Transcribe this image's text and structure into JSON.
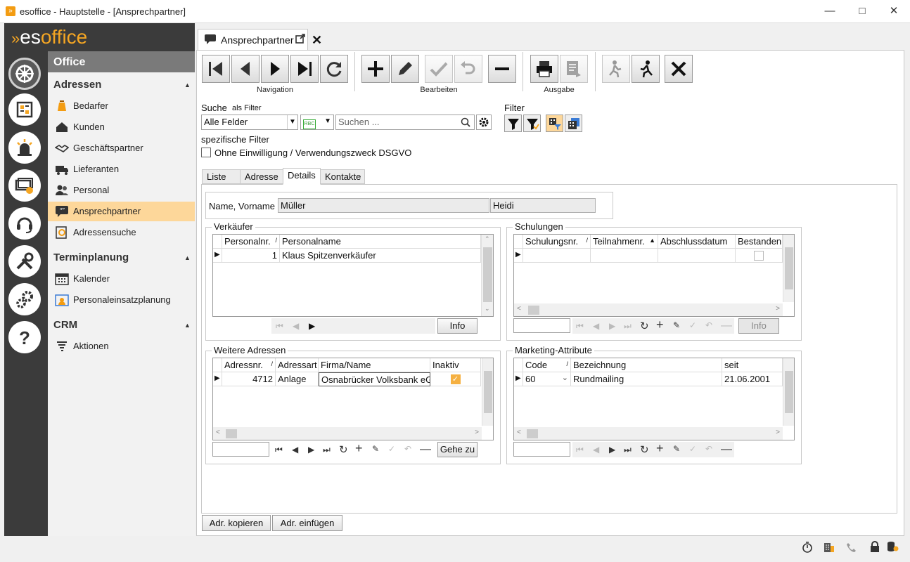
{
  "window": {
    "title": "esoffice - Hauptstelle - [Ansprechpartner]"
  },
  "brand": {
    "logo_es": "es",
    "logo_office": "office"
  },
  "nav": {
    "header": "Office",
    "groups": [
      {
        "title": "Adressen",
        "items": [
          "Bedarfer",
          "Kunden",
          "Geschäftspartner",
          "Lieferanten",
          "Personal",
          "Ansprechpartner",
          "Adressensuche"
        ]
      },
      {
        "title": "Terminplanung",
        "items": [
          "Kalender",
          "Personaleinsatzplanung"
        ]
      },
      {
        "title": "CRM",
        "items": [
          "Aktionen"
        ]
      }
    ],
    "selected": "Ansprechpartner"
  },
  "doc_tab": {
    "label": "Ansprechpartner"
  },
  "toolbar": {
    "navigation_label": "Navigation",
    "bearbeiten_label": "Bearbeiten",
    "ausgabe_label": "Ausgabe"
  },
  "search": {
    "label": "Suche",
    "as_filter": "als Filter",
    "field_select": "Alle Felder",
    "placeholder": "Suchen ...",
    "filter_label": "Filter"
  },
  "specific_filter": {
    "label": "spezifische Filter",
    "checkbox_label": "Ohne Einwilligung / Verwendungszweck DSGVO",
    "checked": false
  },
  "tabs": [
    "Liste",
    "Adresse",
    "Details",
    "Kontakte"
  ],
  "active_tab": "Details",
  "name": {
    "label": "Name, Vorname",
    "last": "Müller",
    "first": "Heidi"
  },
  "verkaeufer": {
    "title": "Verkäufer",
    "columns": [
      "Personalnr.",
      "Personalname"
    ],
    "rows": [
      [
        "1",
        "Klaus Spitzenverkäufer"
      ]
    ],
    "info_btn": "Info"
  },
  "schulungen": {
    "title": "Schulungen",
    "columns": [
      "Schulungsnr.",
      "Teilnahmenr.",
      "Abschlussdatum",
      "Bestanden"
    ],
    "info_btn": "Info"
  },
  "weitere": {
    "title": "Weitere Adressen",
    "columns": [
      "Adressnr.",
      "Adressart",
      "Firma/Name",
      "Inaktiv"
    ],
    "rows": [
      [
        "4712",
        "Anlage",
        "Osnabrücker Volksbank eG"
      ]
    ],
    "goto_btn": "Gehe zu"
  },
  "marketing": {
    "title": "Marketing-Attribute",
    "columns": [
      "Code",
      "Bezeichnung",
      "seit"
    ],
    "rows": [
      [
        "60",
        "Rundmailing",
        "21.06.2001"
      ]
    ]
  },
  "bottom": {
    "copy_btn": "Adr. kopieren",
    "paste_btn": "Adr. einfügen"
  },
  "colors": {
    "accent": "#f5a623",
    "selected": "#fdd79a",
    "rail": "#3b3b3b"
  }
}
